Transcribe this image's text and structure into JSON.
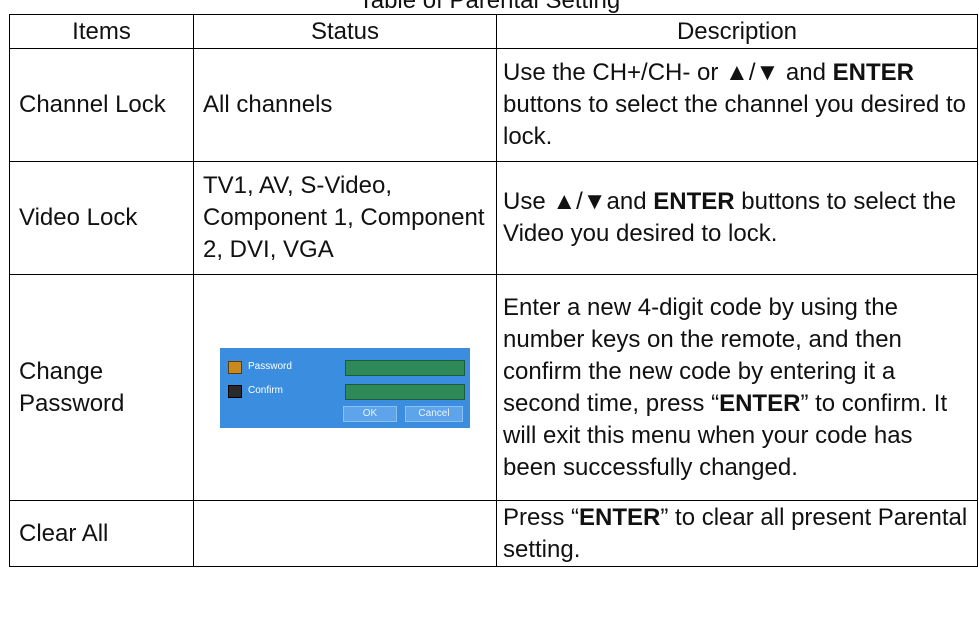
{
  "caption": "Table of Parental Setting",
  "headers": {
    "items": "Items",
    "status": "Status",
    "description": "Description"
  },
  "rows": [
    {
      "item": "Channel Lock",
      "status": "All channels",
      "desc_parts": [
        "Use the CH+/CH-  or ▲/▼ and ",
        "ENTER",
        " buttons to select the channel you desired to lock."
      ]
    },
    {
      "item": "Video Lock",
      "status": "TV1, AV, S-Video, Component 1, Component 2, DVI, VGA",
      "desc_parts": [
        "Use ▲/▼and ",
        "ENTER",
        " buttons to select the Video you desired to lock."
      ]
    },
    {
      "item": "Change Password",
      "status": "",
      "desc_parts": [
        "Enter a new 4-digit code by using the number keys on the remote, and then confirm the new code by entering it a second time, press “",
        "ENTER",
        "” to confirm. It will exit this menu when your code has been successfully changed."
      ]
    },
    {
      "item": "Clear All",
      "status": "",
      "desc_parts": [
        "Press “",
        "ENTER",
        "” to clear all present Parental setting."
      ]
    }
  ],
  "password_dialog": {
    "password_label": "Password",
    "confirm_label": "Confirm",
    "ok_label": "OK",
    "cancel_label": "Cancel",
    "password_icon": "lock-open-icon",
    "confirm_icon": "lock-closed-icon",
    "background_color": "#3b8de0",
    "field_color": "#2e8a58"
  }
}
